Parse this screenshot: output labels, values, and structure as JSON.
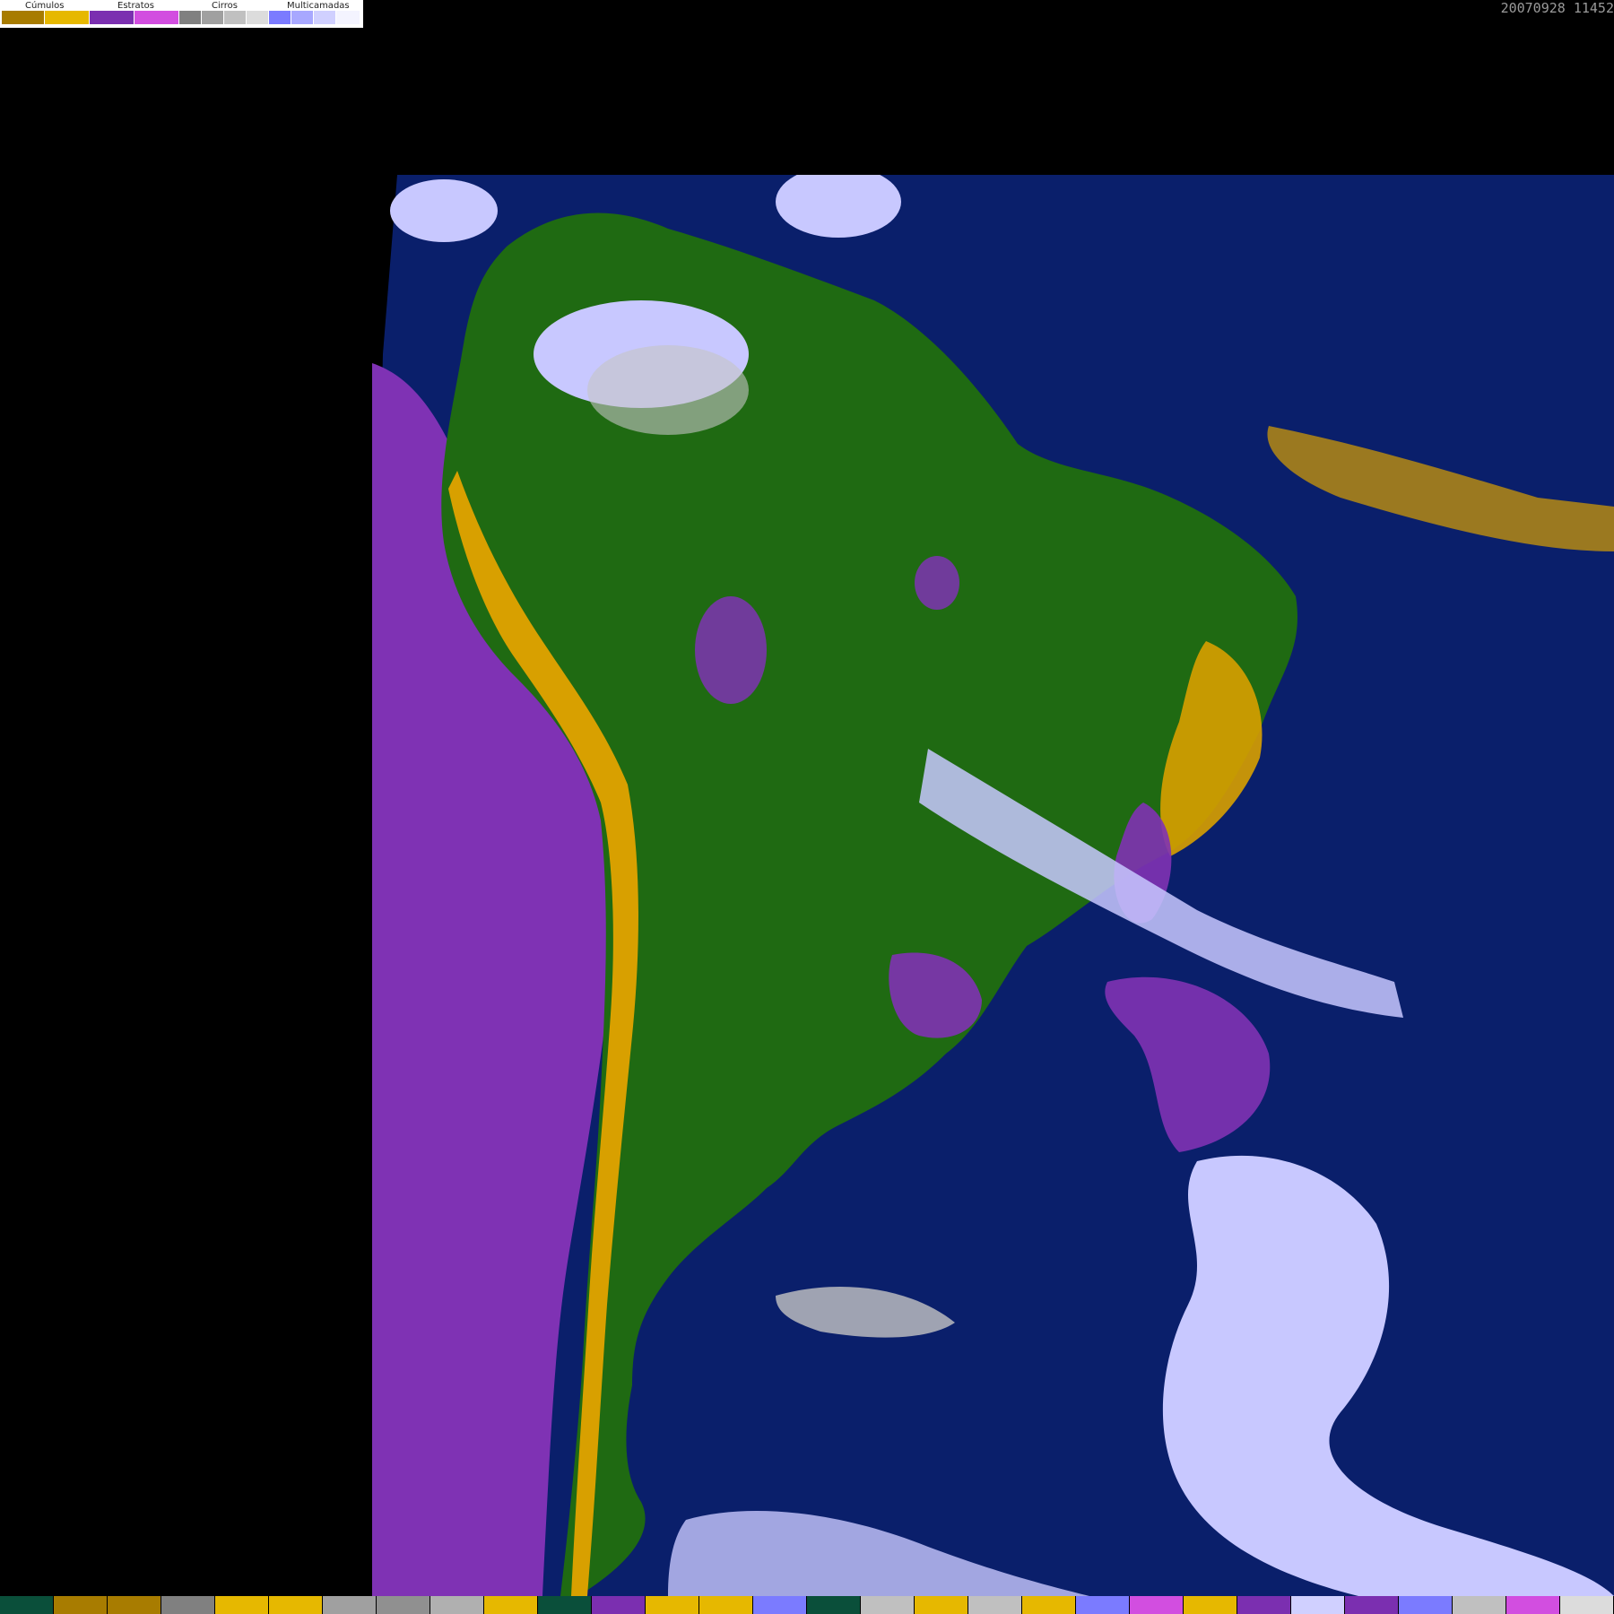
{
  "legend": {
    "groups": [
      {
        "label": "Cúmulos",
        "colors": [
          "#a87c00",
          "#e6b800"
        ]
      },
      {
        "label": "Estratos",
        "colors": [
          "#7b2fb0",
          "#d24ee0"
        ]
      },
      {
        "label": "Cirros",
        "colors": [
          "#808080",
          "#a0a0a0",
          "#c0c0c0",
          "#dcdcdc"
        ]
      },
      {
        "label": "Multicamadas",
        "colors": [
          "#7b7bff",
          "#a8a8ff",
          "#d0d0ff",
          "#f4f4ff"
        ]
      }
    ]
  },
  "timestamp": "20070928 11452",
  "map": {
    "ocean_color": "#0a1f6b",
    "land_color": "#1f6a12",
    "stratus_color": "#7f32b4",
    "cumulus_color": "#d8a000",
    "cirrus_color": "#c4c4c4",
    "multilayer_color": "#c8c8ff"
  },
  "bottom_strip": {
    "colors": [
      "#0a4f3a",
      "#a87c00",
      "#a87c00",
      "#808080",
      "#e6b800",
      "#e6b800",
      "#a0a0a0",
      "#909090",
      "#b0b0b0",
      "#e6b800",
      "#0a4f3a",
      "#7b2fb0",
      "#e6b800",
      "#e6b800",
      "#7b7bff",
      "#0a4f3a",
      "#c0c0c0",
      "#e6b800",
      "#c0c0c0",
      "#e6b800",
      "#7b7bff",
      "#d24ee0",
      "#e6b800",
      "#7b2fb0",
      "#d0d0ff",
      "#7b2fb0",
      "#7b7bff",
      "#c0c0c0",
      "#d24ee0",
      "#dcdcdc"
    ]
  }
}
